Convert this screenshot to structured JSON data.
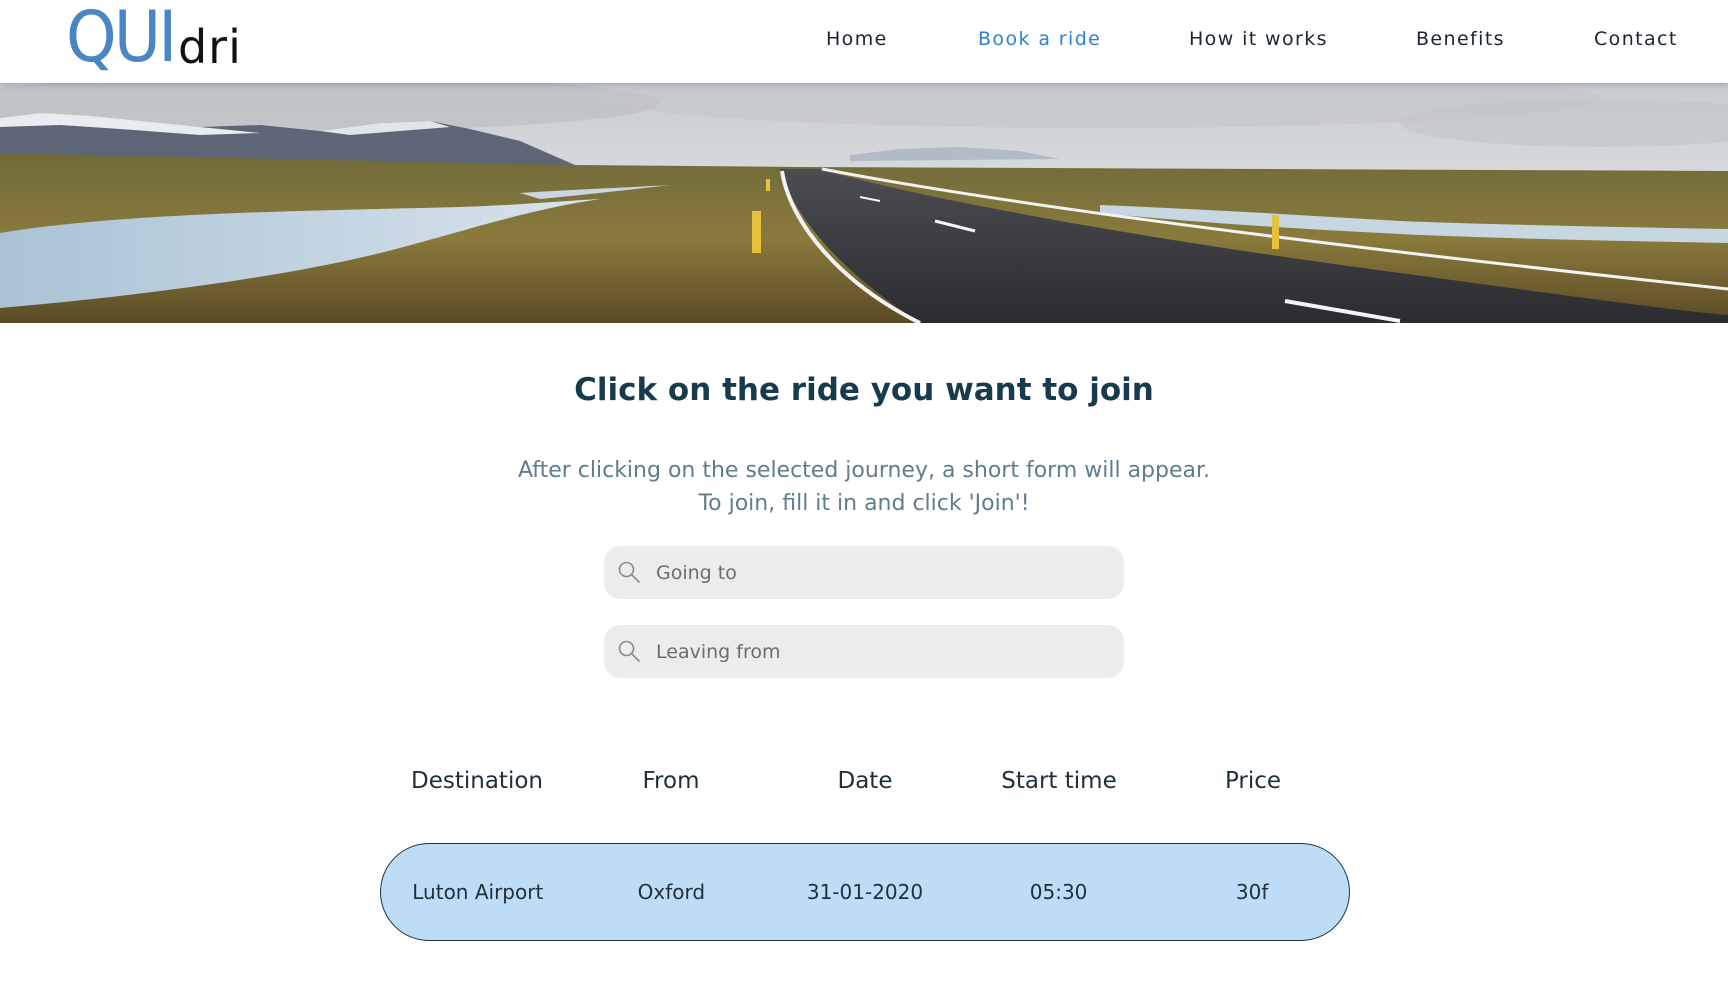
{
  "brand": {
    "logo_primary": "QUI",
    "logo_secondary": "dri",
    "logo_primary_color": "#4a86c5",
    "logo_secondary_color": "#111111"
  },
  "nav": {
    "items": [
      {
        "label": "Home",
        "active": false
      },
      {
        "label": "Book a ride",
        "active": true
      },
      {
        "label": "How it works",
        "active": false
      },
      {
        "label": "Benefits",
        "active": false
      },
      {
        "label": "Contact",
        "active": false
      }
    ],
    "active_color": "#2f80d8"
  },
  "hero": {
    "description": "panoramic road landscape banner"
  },
  "main": {
    "title": "Click on the ride you want to join",
    "subtitle_line1": "After clicking on the selected journey, a short form will appear.",
    "subtitle_line2": "To join, fill it in and click 'Join'!"
  },
  "search": {
    "going_to_placeholder": "Going to",
    "leaving_from_placeholder": "Leaving from",
    "going_to_value": "",
    "leaving_from_value": ""
  },
  "rides_table": {
    "headers": [
      "Destination",
      "From",
      "Date",
      "Start time",
      "Price"
    ],
    "rows": [
      {
        "destination": "Luton Airport",
        "from": "Oxford",
        "date": "31-01-2020",
        "start_time": "05:30",
        "price": "30f"
      }
    ],
    "row_color": "#bddcf6"
  }
}
